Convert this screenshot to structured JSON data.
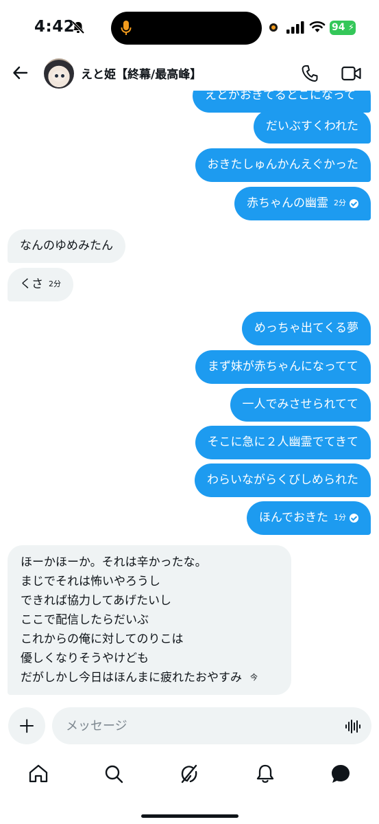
{
  "status_bar": {
    "time": "4:42",
    "battery": "94"
  },
  "header": {
    "contact_name": "えと姫【終幕/最高峰】"
  },
  "messages": {
    "partial": "えとかおきてるとこになって",
    "o1": "だいぶすくわれた",
    "o2": "おきたしゅんかんえぐかった",
    "o3": "赤ちゃんの幽霊",
    "o3_time": "2分",
    "i1": "なんのゆめみたん",
    "i2": "くさ",
    "i2_time": "2分",
    "o4": "めっちゃ出てくる夢",
    "o5": "まず妹が赤ちゃんになってて",
    "o6": "一人でみさせられてて",
    "o7": "そこに急に２人幽霊でてきて",
    "o8": "わらいながらくびしめられた",
    "o9": "ほんでおきた",
    "o9_time": "1分",
    "reply_lines": [
      "ほーかほーか。それは辛かったな。",
      "まじでそれは怖いやろうし",
      "できれば協力してあげたいし",
      "ここで配信したらだいぶ",
      "これからの俺に対してのりこは",
      "優しくなりそうやけども",
      "だがしかし今日はほんまに疲れたおやすみ"
    ],
    "reply_time": "今"
  },
  "composer": {
    "placeholder": "メッセージ"
  },
  "icons": {
    "back": "back-arrow-icon",
    "call": "phone-icon",
    "video": "video-camera-icon",
    "home": "home-icon",
    "search": "search-icon",
    "grok": "grok-icon",
    "notifications": "bell-icon",
    "messages": "messages-icon"
  },
  "colors": {
    "accent": "#1d9bf0",
    "incoming_bubble": "#eff3f4"
  }
}
